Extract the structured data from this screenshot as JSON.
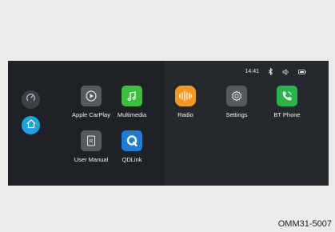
{
  "status_bar": {
    "time": "14:41",
    "icons": [
      "bluetooth-icon",
      "volume-icon",
      "battery-icon"
    ]
  },
  "sidebar": {
    "items": [
      {
        "icon": "gauge-icon"
      },
      {
        "icon": "home-icon",
        "active": true
      }
    ]
  },
  "apps": [
    {
      "label": "Apple CarPlay",
      "icon": "carplay-icon",
      "color": "#555a60"
    },
    {
      "label": "Multimedia",
      "icon": "music-note-icon",
      "color": "#3cbf3c"
    },
    {
      "label": "Radio",
      "icon": "radio-icon",
      "color": "#f39a1e"
    },
    {
      "label": "Settings",
      "icon": "gear-icon",
      "color": "#555a60"
    },
    {
      "label": "BT Phone",
      "icon": "phone-icon",
      "color": "#28b44a"
    },
    {
      "label": "User Manual",
      "icon": "manual-icon",
      "color": "#555a60"
    },
    {
      "label": "QDLink",
      "icon": "qdlink-icon",
      "color": "#1e7ed6"
    }
  ],
  "caption": "OMM31-5007",
  "colors": {
    "screen_bg": "#1e2226",
    "accent": "#1aa3e0"
  }
}
